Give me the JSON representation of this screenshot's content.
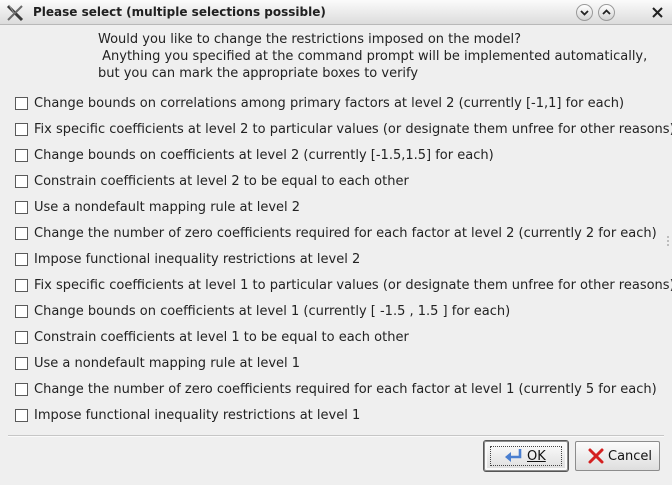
{
  "window": {
    "title": "Please select (multiple selections possible)"
  },
  "prompt": {
    "line1": "Would you like to change the restrictions imposed on the model?",
    "line2": " Anything you specified at the command prompt will be implemented automatically,",
    "line3": "but you can mark the appropriate boxes to verify"
  },
  "options": [
    {
      "label": "Change bounds on correlations among primary factors at level 2 (currently [-1,1] for each)",
      "checked": false
    },
    {
      "label": "Fix specific coefficients at level 2 to particular values (or designate them unfree for other reasons)",
      "checked": false
    },
    {
      "label": "Change bounds on coefficients at level 2 (currently [-1.5,1.5] for each)",
      "checked": false
    },
    {
      "label": "Constrain coefficients at level 2 to be equal to each other",
      "checked": false
    },
    {
      "label": "Use a nondefault mapping rule at level 2",
      "checked": false
    },
    {
      "label": "Change the number of zero coefficients required for each factor at level 2 (currently 2 for each)",
      "checked": false
    },
    {
      "label": "Impose functional inequality restrictions at level 2",
      "checked": false
    },
    {
      "label": "Fix specific coefficients at level 1 to particular values (or designate them unfree for other reasons)",
      "checked": false
    },
    {
      "label": "Change bounds on coefficients at level 1 (currently [ -1.5 , 1.5 ] for each)",
      "checked": false
    },
    {
      "label": "Constrain coefficients at level 1 to be equal to each other",
      "checked": false
    },
    {
      "label": "Use a nondefault mapping rule at level 1",
      "checked": false
    },
    {
      "label": "Change the number of zero coefficients required for each factor at level 1 (currently 5 for each)",
      "checked": false
    },
    {
      "label": "Impose functional inequality restrictions at level 1",
      "checked": false
    }
  ],
  "buttons": {
    "ok_label": "OK",
    "cancel_label": "Cancel"
  },
  "icons": {
    "app": "x-logo-icon",
    "minimize": "chevron-down-icon",
    "maximize": "chevron-up-icon",
    "close": "close-icon",
    "ok": "arrow-left-return-icon",
    "cancel": "red-x-icon"
  },
  "colors": {
    "background": "#efefef",
    "cancel_icon": "#d42020",
    "ok_icon": "#4a7fd0"
  }
}
